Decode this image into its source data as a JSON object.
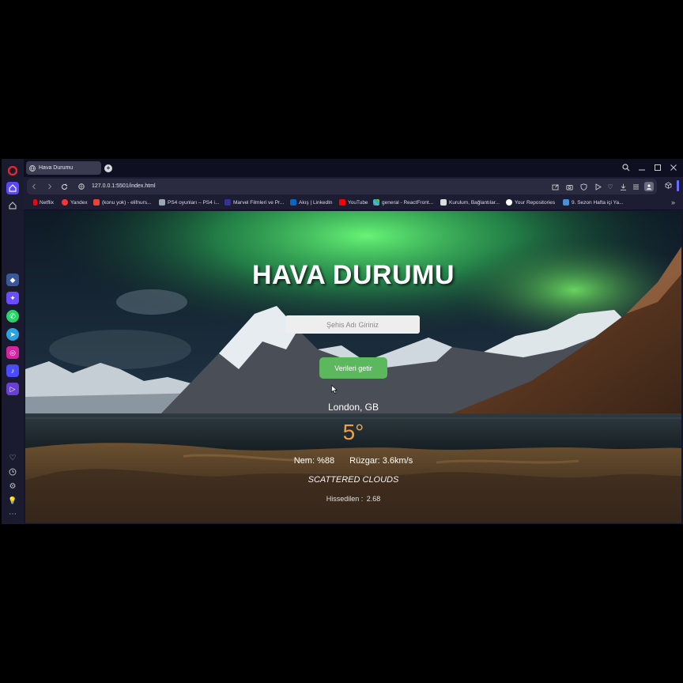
{
  "browser": {
    "tab_title": "Hava Durumu",
    "url": "127.0.0.1:5501/index.html",
    "bookmarks": [
      {
        "label": "Netflix",
        "icon": "netflix-icon",
        "color": "#e50914"
      },
      {
        "label": "Yandex",
        "icon": "yandex-icon",
        "color": "#f33"
      },
      {
        "label": "(konu yok) - elifnurs...",
        "icon": "gmail-icon",
        "color": "#ea4335"
      },
      {
        "label": "PS4 oyunları – PS4 i...",
        "icon": "page-icon",
        "color": "#9aa"
      },
      {
        "label": "Marvel Filmleri ve Pr...",
        "icon": "marvel-icon",
        "color": "#333399"
      },
      {
        "label": "Akış | LinkedIn",
        "icon": "linkedin-icon",
        "color": "#0a66c2"
      },
      {
        "label": "YouTube",
        "icon": "youtube-icon",
        "color": "#ff0000"
      },
      {
        "label": "general - ReactFront...",
        "icon": "slack-icon",
        "color": "#e01e5a"
      },
      {
        "label": "Kurulum, Bağlantılar...",
        "icon": "doc-icon",
        "color": "#dddddd"
      },
      {
        "label": "Your Repositories",
        "icon": "github-icon",
        "color": "#ffffff"
      },
      {
        "label": "9. Sezon Hafta içi Ya...",
        "icon": "page-icon",
        "color": "#4a90d9"
      }
    ]
  },
  "app": {
    "title": "HAVA DURUMU",
    "input_placeholder": "Şehis Adı Giriniz",
    "button_label": "Verileri getir",
    "location": "London, GB",
    "temperature": "5°",
    "humidity": "Nem: %88",
    "wind": "Rüzgar: 3.6km/s",
    "description": "SCATTERED CLOUDS",
    "feels_label": "Hissedilen :",
    "feels_value": "2.68"
  },
  "colors": {
    "button": "#5cb85c",
    "temperature": "#f0a040"
  }
}
